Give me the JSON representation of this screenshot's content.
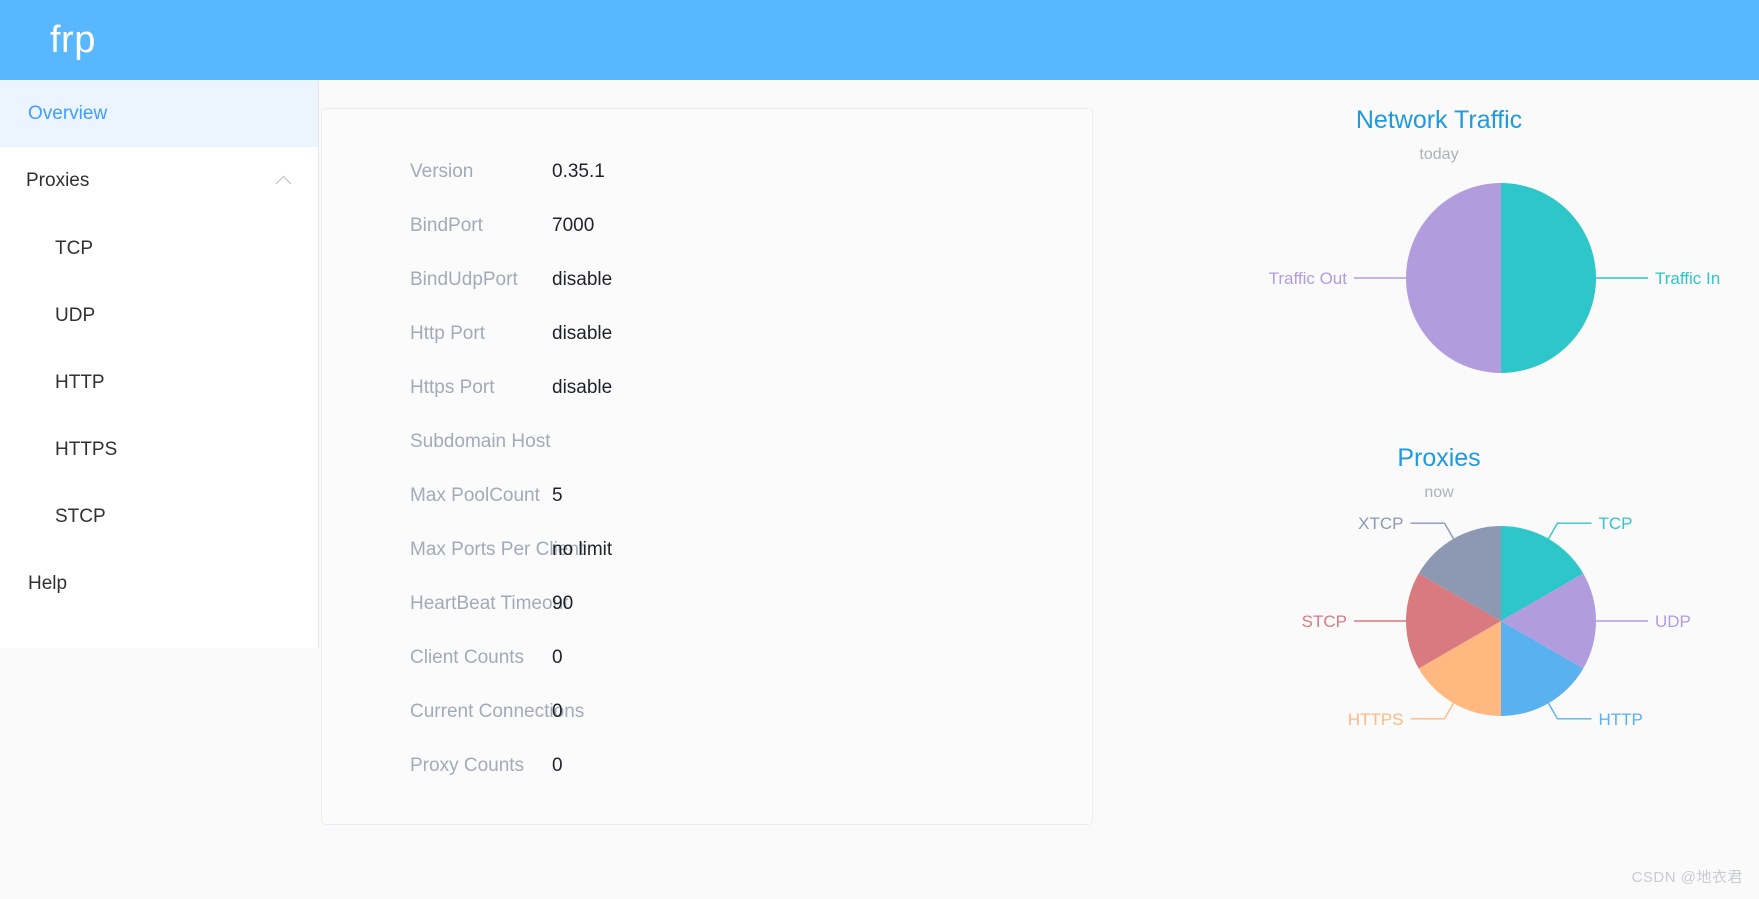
{
  "header": {
    "brand": "frp",
    "background": "#58b7ff"
  },
  "sidebar": {
    "overview": {
      "label": "Overview"
    },
    "proxies_group": {
      "label": "Proxies",
      "icon": "chevron-up-icon",
      "expanded": true
    },
    "proxy_items": [
      {
        "label": "TCP"
      },
      {
        "label": "UDP"
      },
      {
        "label": "HTTP"
      },
      {
        "label": "HTTPS"
      },
      {
        "label": "STCP"
      }
    ],
    "help": {
      "label": "Help"
    }
  },
  "server_info": {
    "rows": [
      {
        "label": "Version",
        "value": "0.35.1"
      },
      {
        "label": "BindPort",
        "value": "7000"
      },
      {
        "label": "BindUdpPort",
        "value": "disable"
      },
      {
        "label": "Http Port",
        "value": "disable"
      },
      {
        "label": "Https Port",
        "value": "disable"
      },
      {
        "label": "Subdomain Host",
        "value": ""
      },
      {
        "label": "Max PoolCount",
        "value": "5"
      },
      {
        "label": "Max Ports Per Client",
        "value": "no limit"
      },
      {
        "label": "HeartBeat Timeout",
        "value": "90"
      },
      {
        "label": "Client Counts",
        "value": "0"
      },
      {
        "label": "Current Connections",
        "value": "0"
      },
      {
        "label": "Proxy Counts",
        "value": "0"
      }
    ]
  },
  "chart_data": [
    {
      "id": "network-traffic",
      "type": "pie",
      "title": "Network Traffic",
      "subtitle": "today",
      "legend_position": "labels-outside",
      "categories": [
        "Traffic In",
        "Traffic Out"
      ],
      "values": [
        50,
        50
      ],
      "colors": [
        "#2ec7c9",
        "#b19cde"
      ],
      "labels": [
        {
          "name": "Traffic In",
          "value": 50,
          "color": "#2ec7c9",
          "side": "right"
        },
        {
          "name": "Traffic Out",
          "value": 50,
          "color": "#b19cde",
          "side": "left"
        }
      ]
    },
    {
      "id": "proxies",
      "type": "pie",
      "title": "Proxies",
      "subtitle": "now",
      "legend_position": "labels-outside",
      "categories": [
        "TCP",
        "UDP",
        "HTTP",
        "HTTPS",
        "STCP",
        "XTCP"
      ],
      "values": [
        1,
        1,
        1,
        1,
        1,
        1
      ],
      "colors": [
        "#2ec7c9",
        "#b19cde",
        "#5ab1ef",
        "#ffb980",
        "#d87a80",
        "#8d98b3"
      ],
      "labels": [
        {
          "name": "TCP",
          "value": 1,
          "color": "#2ec7c9",
          "side": "right"
        },
        {
          "name": "UDP",
          "value": 1,
          "color": "#b19cde",
          "side": "right"
        },
        {
          "name": "HTTP",
          "value": 1,
          "color": "#5ab1ef",
          "side": "right"
        },
        {
          "name": "HTTPS",
          "value": 1,
          "color": "#ffb980",
          "side": "left"
        },
        {
          "name": "STCP",
          "value": 1,
          "color": "#d87a80",
          "side": "left"
        },
        {
          "name": "XTCP",
          "value": 1,
          "color": "#8d98b3",
          "side": "left"
        }
      ]
    }
  ],
  "watermark": {
    "text": "CSDN @地衣君"
  }
}
